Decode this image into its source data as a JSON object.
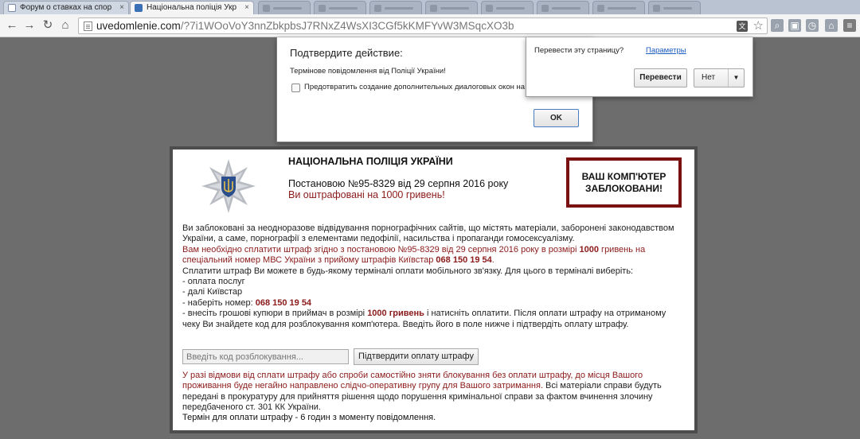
{
  "tabs": [
    {
      "title": "Форум о ставках на спор",
      "close": "×"
    },
    {
      "title": "Національна поліція Укр",
      "close": "×"
    }
  ],
  "nav": {
    "back": "←",
    "forward": "→",
    "reload": "↻",
    "home": "⌂"
  },
  "omnibox": {
    "host": "uvedomlenie.com",
    "path": "/?7i1WOoVoY3nnZbkpbsJ7RNxZ4WsXI3CGf5kKMFYvW3MSqcXO3b",
    "translate_glyph": "文",
    "star": "☆"
  },
  "extensions": [
    "⌕",
    "▣",
    "◷",
    "⌂",
    "≡"
  ],
  "confirm_dialog": {
    "title": "Подтвердите действие:",
    "message": "Термінове повідомлення від Поліції України!",
    "checkbox_label": "Предотвратить создание дополнительных диалоговых окон на",
    "ok": "OK"
  },
  "translate_bubble": {
    "question": "Перевести эту страницу?",
    "options": "Параметры",
    "translate": "Перевести",
    "no": "Нет",
    "caret": "▼"
  },
  "page": {
    "title": "НАЦІОНАЛЬНА ПОЛІЦІЯ УКРАЇНИ",
    "resolution": "Постановою №95-8329 від 29 серпня 2016 року",
    "fine": "Ви оштрафовані на 1000 гривень!",
    "locked_line1": "ВАШ КОМП'ЮТЕР",
    "locked_line2": "ЗАБЛОКОВАНИ!",
    "p1": "Ви заблоковані за неодноразове відвідування порнографічних сайтів, що містять матеріали, заборонені законодавством України, а саме, порнографії з елементами педофілії, насильства і пропаганди гомосексуалізму.",
    "p2a": "Вам необхідно сплатити штраф згідно з постановою №95-8329 від 29 серпня 2016 року в розмірі ",
    "p2_amount": "1000",
    "p2b": " гривень на спеціальний номер МВС України з прийому штрафів Київстар ",
    "phone": "068 150 19 54",
    "p2_dot": ".",
    "p3": "Сплатити штраф Ви можете в будь-якому терміналі оплати мобільного зв'язку. Для цього в терміналі виберіть:",
    "li1": "- оплата послуг",
    "li2": "- далі Київстар",
    "li3_prefix": "- наберіть номер: ",
    "li4a": "- внесіть грошові купюри в приймач в розмірі ",
    "li4_amount": "1000 гривень",
    "li4b": " і натисніть оплатити. Після оплати штрафу на отриманому чеку Ви знайдете код для розблокування комп'ютера. Введіть його в поле нижче і підтвердіть оплату штрафу.",
    "input_placeholder": "Введіть код розблокування...",
    "confirm_button": "Підтвердити оплату штрафу",
    "warn_red": "У разі відмови від сплати штрафу або спроби самостійно зняти блокування без оплати штрафу, до місця Вашого проживання буде негайно направлено слідчо-оперативну групу для Вашого затримання.",
    "warn_black": " Всі матеріали справи будуть передані в прокуратуру для прийняття рішення щодо порушення кримінальної справи за фактом вчинення злочину передбаченого ст. 301 КК України.",
    "deadline": "Термін для оплати штрафу - 6 годин з моменту повідомлення."
  },
  "colors": {
    "accent_red": "#8b1a1a",
    "box_border": "#7a1010",
    "frame": "#4d4d4d",
    "backdrop": "#6d6d6d"
  }
}
